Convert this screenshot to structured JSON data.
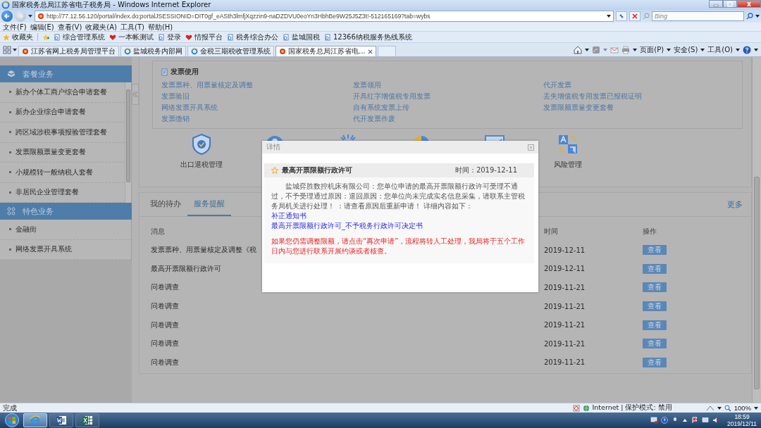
{
  "window": {
    "title": "国家税务总局江苏省电子税务局 - Windows Internet Explorer"
  },
  "address_bar": {
    "url": "http://77.12.56.120/portal/index.do;portalJSESSIONID=DIT0gf_eASth3lmfjXqzzin9-naDZDVU0eoYn3HbhBe9W25J5Z3t!-512165169?tab=wybs"
  },
  "search": {
    "placeholder": "Bing"
  },
  "menu": [
    "文件(F)",
    "编辑(E)",
    "查看(V)",
    "收藏夹(A)",
    "工具(T)",
    "帮助(H)"
  ],
  "favorites": {
    "label": "收藏夹",
    "items": [
      {
        "label": "综合管理系统",
        "kind": "page"
      },
      {
        "label": "一本帐测试",
        "kind": "heart"
      },
      {
        "label": "登录",
        "kind": "page"
      },
      {
        "label": "情报平台",
        "kind": "heart"
      },
      {
        "label": "税务综合办公",
        "kind": "page"
      },
      {
        "label": "盐城国税",
        "kind": "page"
      },
      {
        "label": "12366纳税服务热线系统",
        "kind": "page"
      }
    ]
  },
  "browser_tabs": [
    {
      "label": "江苏省网上税务局管理平台",
      "kind": "emblem",
      "selected": false
    },
    {
      "label": "盐城税务内部网",
      "kind": "ie",
      "selected": false
    },
    {
      "label": "金税三期税收管理系统",
      "kind": "ie",
      "selected": false
    },
    {
      "label": "国家税务总局江苏省电...",
      "kind": "emblem",
      "selected": true
    }
  ],
  "command_bar": [
    "页面(P)",
    "安全(S)",
    "工具(O)"
  ],
  "sidebar": [
    {
      "title": "套餐业务",
      "kind": "package",
      "items": [
        "新办个体工商户综合申请套餐",
        "新办企业综合申请套餐",
        "跨区域涉税事项报验管理套餐",
        "发票限额票量变更套餐",
        "小规模转一般纳税人套餐",
        "非居民企业管理套餐"
      ]
    },
    {
      "title": "特色业务",
      "kind": "feature",
      "items": [
        "金融街",
        "网络发票开具系统"
      ]
    }
  ],
  "invoice_box": {
    "title": "发票使用",
    "columns": [
      [
        "发票票种、用票量核定及调整",
        "发票验旧",
        "网络发票开具系统",
        "发票缴销"
      ],
      [
        "发票领用",
        "开具红字增值税专用发票",
        "自有系统发票上传",
        "代开发票作废"
      ],
      [
        "代开发票",
        "丢失增值税专用发票已报税证明",
        "发票限额票量变更套餐"
      ]
    ]
  },
  "services": [
    {
      "label": "出口退税管理",
      "kind": "shield"
    },
    {
      "kind": "person"
    },
    {
      "kind": "sun"
    },
    {
      "kind": "pie"
    },
    {
      "kind": "chart"
    },
    {
      "label": "风险管理",
      "kind": "translate"
    }
  ],
  "panel_tabs": [
    {
      "label": "我的待办",
      "selected": false
    },
    {
      "label": "服务提醒",
      "selected": true
    }
  ],
  "more": "更多",
  "table": {
    "columns": [
      "消息",
      "时间",
      "操作"
    ],
    "rows": [
      {
        "message": "发票票种、用票量核定及调整《税",
        "time": "2019-12-11",
        "action": "查看"
      },
      {
        "message": "最高开票限额行政许可",
        "time": "2019-12-11",
        "action": "查看"
      },
      {
        "message": "问卷调查",
        "time": "2019-11-21",
        "action": "查看"
      },
      {
        "message": "问卷调查",
        "time": "2019-11-21",
        "action": "查看"
      },
      {
        "message": "问卷调查",
        "time": "2019-11-21",
        "action": "查看"
      },
      {
        "message": "问卷调查",
        "time": "2019-11-21",
        "action": "查看"
      },
      {
        "message": "问卷调查",
        "time": "2019-11-21",
        "action": "查看"
      }
    ]
  },
  "modal": {
    "title": "详情",
    "heading": "最高开票限额行政许可",
    "time": "时间：2019-12-11",
    "paragraph": "盐城弈胜数控机床有限公司：您单位申请的最高开票限额行政许可受理不通过，不予受理通过原因：退回原因：您单位尚未完成实名信息采集，请联系主管税务局机关进行处理！ ：请查看原因后重新申请！ 详细内容如下：",
    "links": [
      "补正通知书",
      "最高开票限额行政许可_不予税务行政许可决定书"
    ],
    "warning": "如果您仍需调整限额，请点击“再次申请”，流程将转人工处理，我局将于五个工作日内与您进行联系开展约谈或者核查。"
  },
  "status_bar": {
    "text": "完成",
    "zone": "Internet | 保护模式: 禁用",
    "zoom": "100%"
  },
  "taskbar": {
    "apps": [
      {
        "kind": "ie",
        "selected": true
      },
      {
        "kind": "word",
        "selected": false
      },
      {
        "kind": "excel",
        "selected": false
      }
    ],
    "time": "18:59",
    "date": "2019/12/11"
  }
}
